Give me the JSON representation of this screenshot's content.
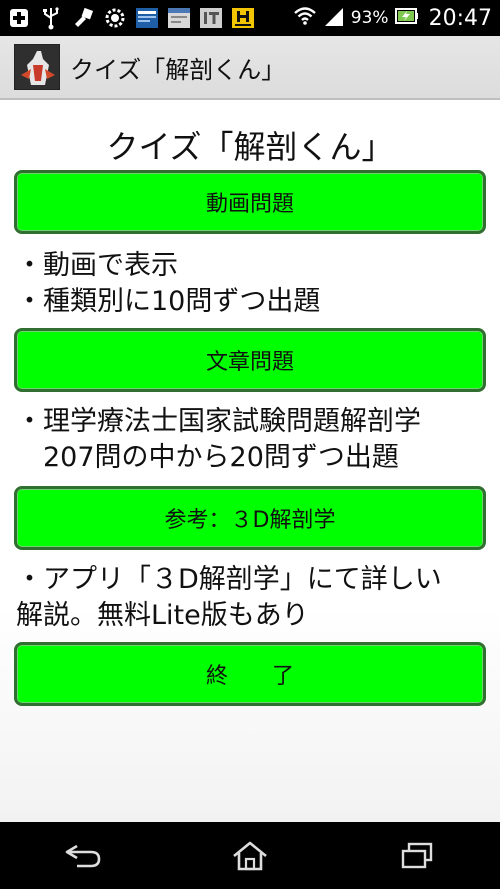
{
  "status_bar": {
    "battery_pct": "93%",
    "time": "20:47",
    "notification_icons": [
      "plus-icon",
      "usb-icon",
      "tool-icon",
      "gear-icon",
      "news-app-icon",
      "browser-app-icon",
      "it-app-icon",
      "h-app-icon"
    ]
  },
  "action_bar": {
    "title": "クイズ「解剖くん」"
  },
  "main": {
    "title": "クイズ「解剖くん」",
    "buttons": [
      {
        "label": "動画問題"
      },
      {
        "label": "文章問題"
      },
      {
        "label": "参考：３D解剖学"
      },
      {
        "label": "終　　了"
      }
    ],
    "descriptions": [
      [
        "・動画で表示",
        "・種類別に10問ずつ出題"
      ],
      [
        "・理学療法士国家試験問題解剖学",
        "　207問の中から20問ずつ出題"
      ],
      [
        "・アプリ「３D解剖学」にて詳しい",
        "解説。無料Lite版もあり"
      ]
    ]
  },
  "colors": {
    "button_fill": "#00ff00",
    "button_border": "#2f6f2f"
  }
}
